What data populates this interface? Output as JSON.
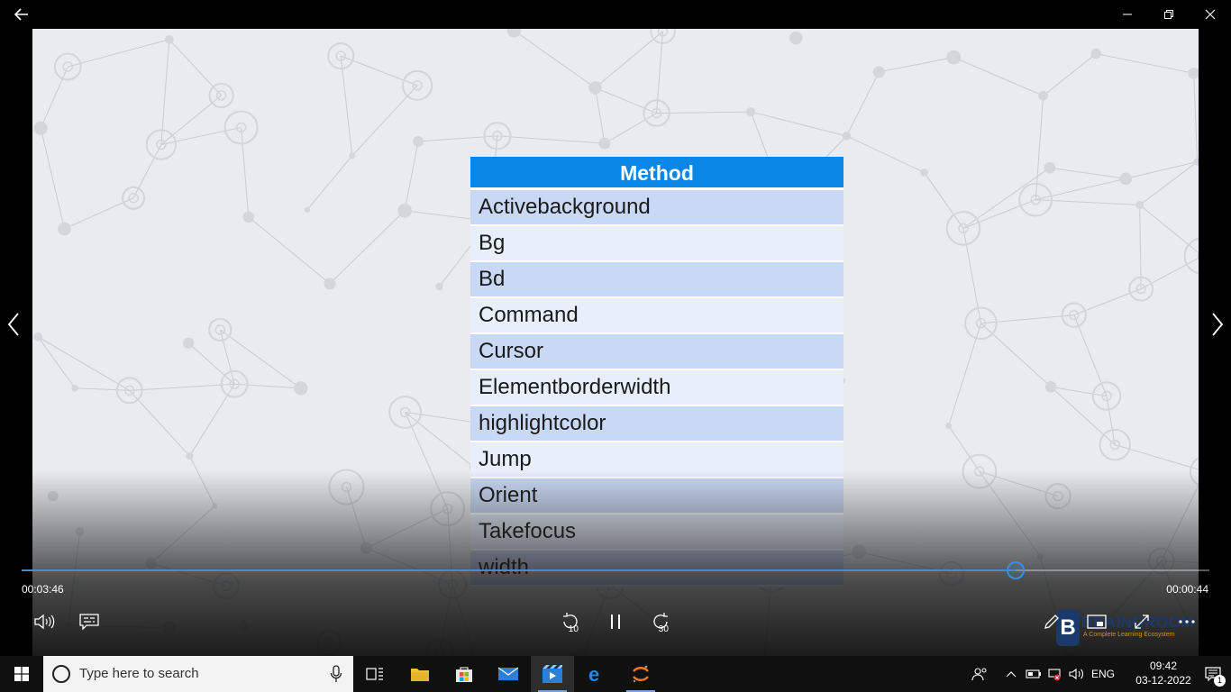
{
  "slide": {
    "header": "Method",
    "rows": [
      "Activebackground",
      "Bg",
      "Bd",
      "Command",
      "Cursor",
      "Elementborderwidth",
      "highlightcolor",
      "Jump",
      "Orient",
      "Takefocus",
      "width"
    ]
  },
  "player": {
    "elapsed": "00:03:46",
    "remaining": "00:00:44",
    "progress_fraction": 0.837,
    "skip_back": "10",
    "skip_forward": "30"
  },
  "watermark": {
    "letter": "B",
    "name": "BRAINGROOM",
    "tagline": "A Complete Learning Ecosystem"
  },
  "taskbar": {
    "search_placeholder": "Type here to search",
    "language": "ENG",
    "time": "09:42",
    "date": "03-12-2022",
    "notification_count": "1"
  },
  "icons": {
    "back": "arrow-left-icon",
    "prev": "chevron-left-icon",
    "next": "chevron-right-icon",
    "volume": "volume-icon",
    "captions": "captions-icon",
    "play_state": "pause-icon",
    "pen": "pen-icon",
    "miniplayer": "miniplayer-icon",
    "fullscreen": "fullscreen-icon",
    "more": "more-icon"
  },
  "colors": {
    "table_header": "#0a87e6",
    "row_dark": "#c9d8f4",
    "row_light": "#e8eefa",
    "seek_accent": "#3a8ee6",
    "taskbar": "#101010"
  }
}
